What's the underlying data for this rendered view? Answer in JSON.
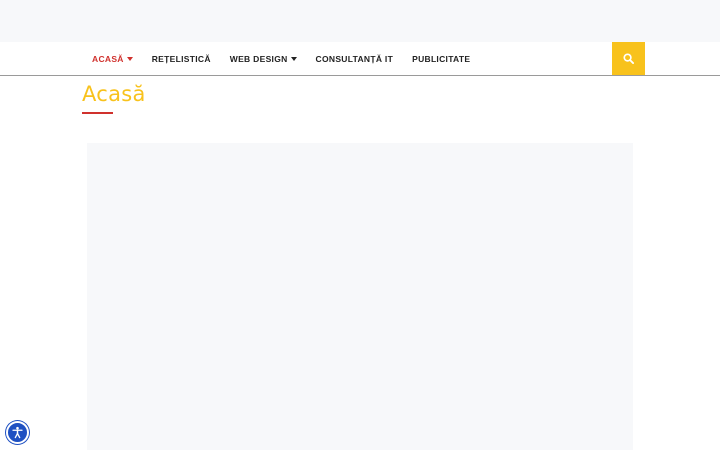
{
  "nav": {
    "items": [
      {
        "label": "ACASĂ",
        "active": true,
        "has_dropdown": true
      },
      {
        "label": "REȚELISTICĂ",
        "active": false,
        "has_dropdown": false
      },
      {
        "label": "WEB DESIGN",
        "active": false,
        "has_dropdown": true
      },
      {
        "label": "CONSULTANȚĂ IT",
        "active": false,
        "has_dropdown": false
      },
      {
        "label": "PUBLICITATE",
        "active": false,
        "has_dropdown": false
      }
    ],
    "search_icon": "search-icon"
  },
  "page": {
    "title": "Acasă"
  },
  "accessibility": {
    "icon": "accessibility-icon"
  },
  "colors": {
    "accent": "#f8c21c",
    "active_nav": "#d0312d",
    "underline": "#d0312d",
    "a11y_button": "#1e50c2"
  }
}
